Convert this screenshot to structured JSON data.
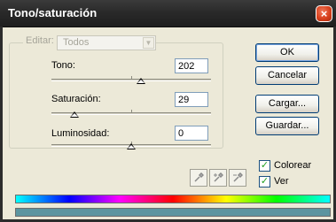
{
  "window": {
    "title": "Tono/saturación",
    "close_label": "×"
  },
  "edit": {
    "label": "Editar:",
    "value": "Todos"
  },
  "fields": {
    "hue": {
      "label": "Tono:",
      "value": "202",
      "slider_fraction": 0.56
    },
    "saturation": {
      "label": "Saturación:",
      "value": "29",
      "slider_fraction": 0.145
    },
    "lightness": {
      "label": "Luminosidad:",
      "value": "0",
      "slider_fraction": 0.5
    }
  },
  "buttons": {
    "ok": "OK",
    "cancel": "Cancelar",
    "load": "Cargar...",
    "save": "Guardar..."
  },
  "eyedroppers": [
    "eyedropper-icon",
    "eyedropper-plus-icon",
    "eyedropper-minus-icon"
  ],
  "checkboxes": {
    "colorize": {
      "label": "Colorear",
      "checked": true
    },
    "preview": {
      "label": "Ver",
      "checked": true
    }
  },
  "colors": {
    "titlebar": "#2a2a2a",
    "dialog": "#ece9d8",
    "result_bar": "#5c95a0",
    "close_button": "#d8401c"
  }
}
